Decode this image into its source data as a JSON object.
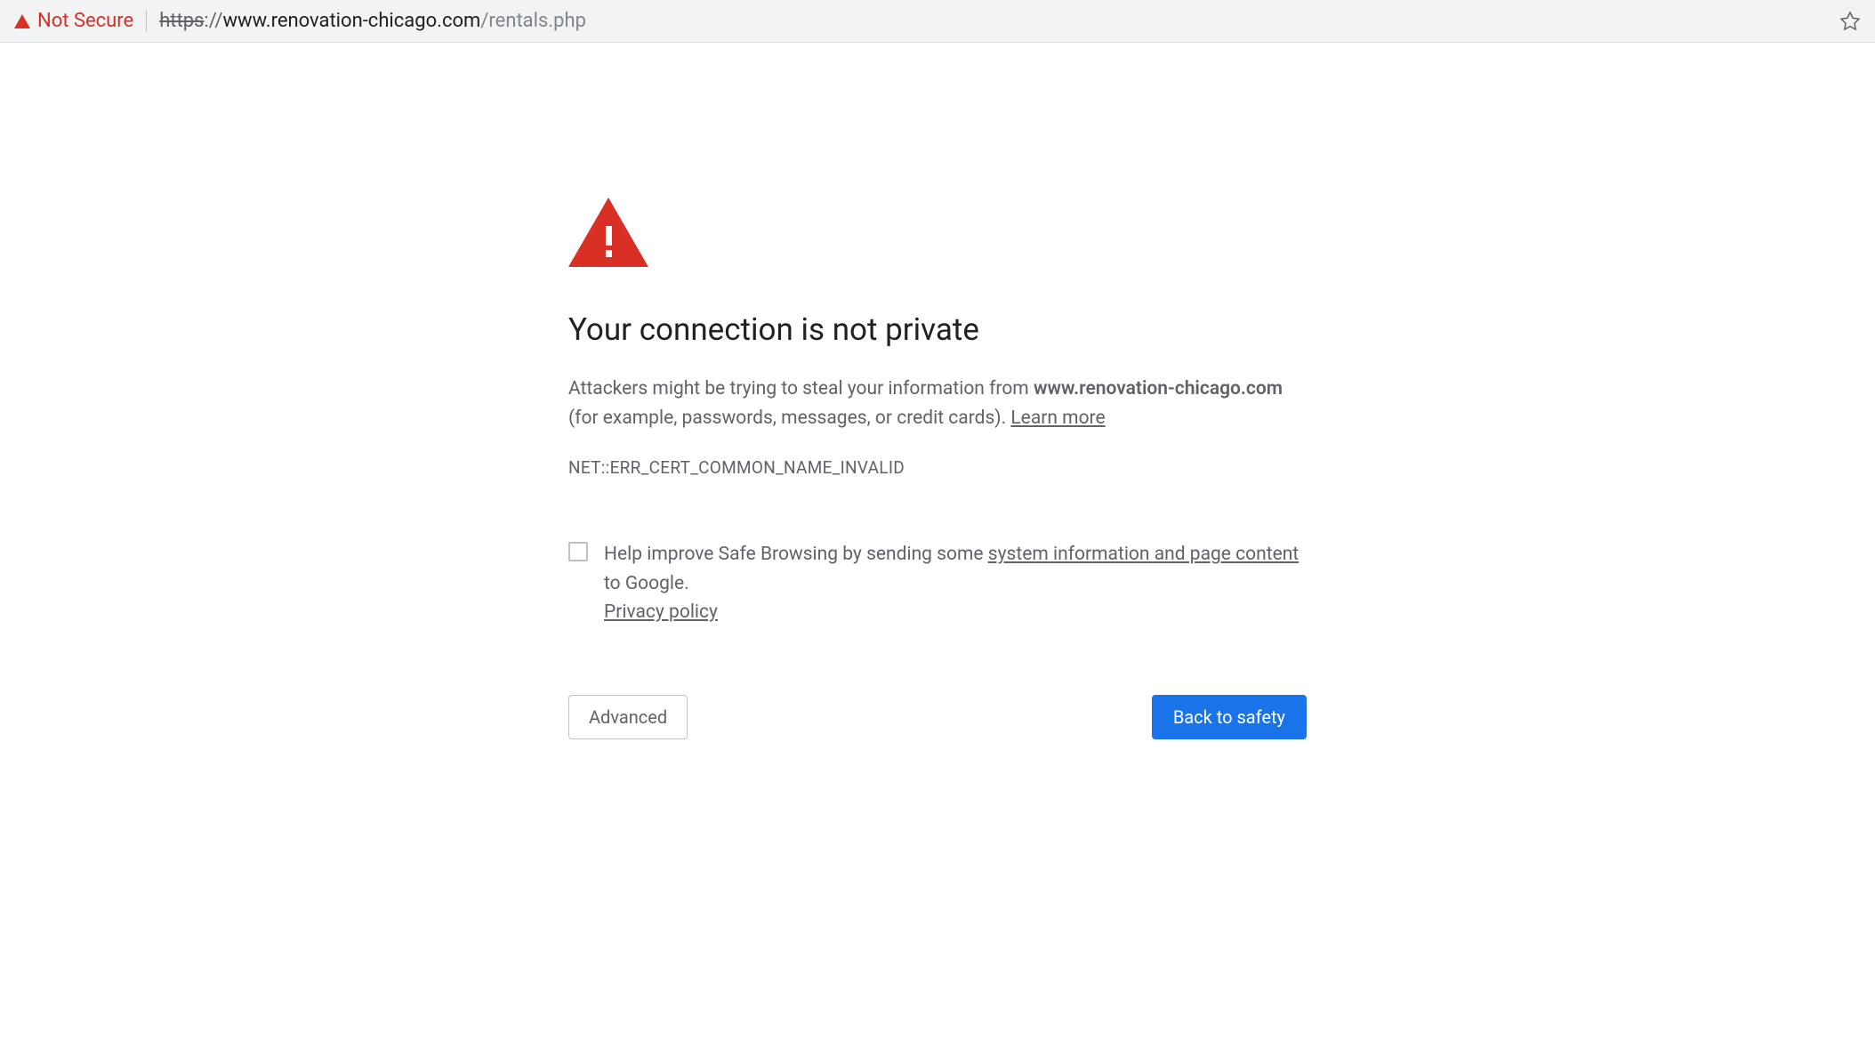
{
  "address_bar": {
    "security_label": "Not Secure",
    "url_scheme": "https",
    "url_separator": "://",
    "url_host": "www.renovation-chicago.com",
    "url_path": "/rentals.php"
  },
  "interstitial": {
    "heading": "Your connection is not private",
    "desc_prefix": "Attackers might be trying to steal your information from ",
    "desc_host": "www.renovation-chicago.com",
    "desc_suffix": " (for example, passwords, messages, or credit cards). ",
    "learn_more": "Learn more",
    "error_code": "NET::ERR_CERT_COMMON_NAME_INVALID",
    "opt_in_prefix": "Help improve Safe Browsing by sending some ",
    "opt_in_link": "system information and page content",
    "opt_in_suffix": " to Google. ",
    "privacy_policy": "Privacy policy",
    "advanced_label": "Advanced",
    "back_label": "Back to safety"
  }
}
